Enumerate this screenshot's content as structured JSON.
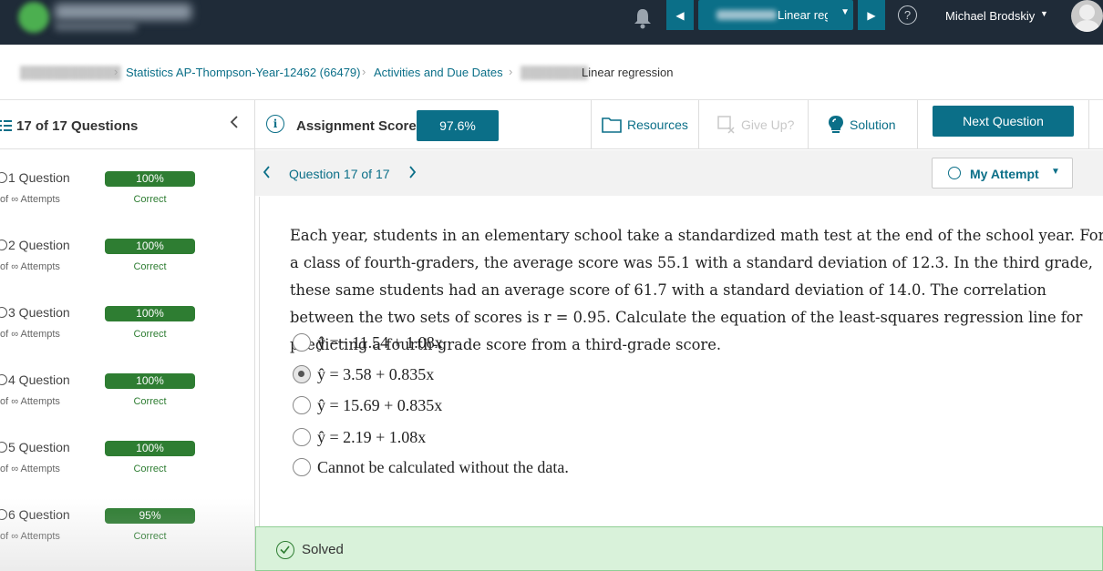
{
  "topbar": {
    "assignment_select_label": "Linear reg",
    "username": "Michael Brodskiy"
  },
  "breadcrumb": {
    "course": "Statistics AP-Thompson-Year-12462 (66479)",
    "activities": "Activities and Due Dates",
    "current": "Linear regression"
  },
  "sidebar": {
    "title": "17 of 17 Questions",
    "questions": [
      {
        "label": "1 Question",
        "attempts": "of ∞ Attempts",
        "score": "100%",
        "status": "Correct"
      },
      {
        "label": "2 Question",
        "attempts": "of ∞ Attempts",
        "score": "100%",
        "status": "Correct"
      },
      {
        "label": "3 Question",
        "attempts": "of ∞ Attempts",
        "score": "100%",
        "status": "Correct"
      },
      {
        "label": "4 Question",
        "attempts": "of ∞ Attempts",
        "score": "100%",
        "status": "Correct"
      },
      {
        "label": "5 Question",
        "attempts": "of ∞ Attempts",
        "score": "100%",
        "status": "Correct"
      },
      {
        "label": "6 Question",
        "attempts": "of ∞ Attempts",
        "score": "95%",
        "status": "Correct"
      }
    ]
  },
  "toolbar": {
    "score_label": "Assignment Score:",
    "score_value": "97.6%",
    "resources": "Resources",
    "give_up": "Give Up?",
    "solution": "Solution",
    "next_question": "Next Question"
  },
  "question_nav": {
    "title": "Question 17 of 17",
    "attempt_label": "My Attempt"
  },
  "question": {
    "text": "Each year, students in an elementary school take a standardized math test at the end of the school year. For a class of fourth-graders, the average score was 55.1 with a standard deviation of 12.3. In the third grade, these same students had an average score of 61.7 with a standard deviation of 14.0. The correlation between the two sets of scores is r = 0.95. Calculate the equation of the least-squares regression line for predicting a fourth-grade score from a third-grade score.",
    "options": [
      {
        "text": "ŷ =− 11.54 + 1.08x",
        "selected": false
      },
      {
        "text": "ŷ = 3.58 + 0.835x",
        "selected": true
      },
      {
        "text": "ŷ = 15.69 + 0.835x",
        "selected": false
      },
      {
        "text": "ŷ = 2.19 + 1.08x",
        "selected": false
      },
      {
        "text": "Cannot be calculated without the data.",
        "selected": false
      }
    ]
  },
  "status": {
    "label": "Solved"
  },
  "colors": {
    "topbar": "#1f2b38",
    "accent": "#0b6f88",
    "success": "#2e7d32",
    "solved_bg": "#d9f2da"
  }
}
